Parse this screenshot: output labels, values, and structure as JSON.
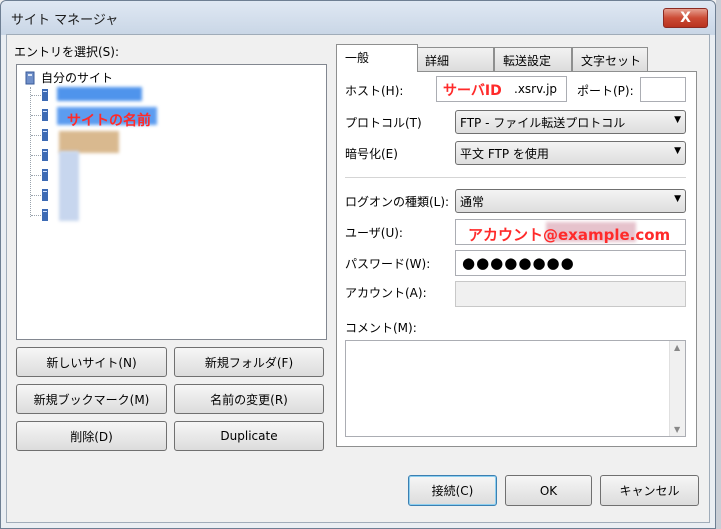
{
  "window": {
    "title": "サイト マネージャ",
    "close": "X"
  },
  "left": {
    "entry_label": "エントリを選択(S):",
    "root": "自分のサイト",
    "site_note": "サイトの名前"
  },
  "buttons": {
    "new_site": "新しいサイト(N)",
    "new_folder": "新規フォルダ(F)",
    "new_bookmark": "新規ブックマーク(M)",
    "rename": "名前の変更(R)",
    "delete": "削除(D)",
    "duplicate": "Duplicate",
    "connect": "接続(C)",
    "ok": "OK",
    "cancel": "キャンセル"
  },
  "tabs": [
    "一般",
    "詳細",
    "転送設定",
    "文字セット"
  ],
  "form": {
    "host_label": "ホスト(H):",
    "host_note": "サーバID",
    "host_value": ".xsrv.jp",
    "port_label": "ポート(P):",
    "port_value": "",
    "protocol_label": "プロトコル(T)",
    "protocol_value": "FTP - ファイル転送プロトコル",
    "encryption_label": "暗号化(E)",
    "encryption_value": "平文 FTP を使用",
    "logon_label": "ログオンの種類(L):",
    "logon_value": "通常",
    "user_label": "ユーザ(U):",
    "user_note": "アカウント@example.com",
    "password_label": "パスワード(W):",
    "password_value": "●●●●●●●●",
    "account_label": "アカウント(A):",
    "comment_label": "コメント(M):"
  },
  "icons": {
    "dropdown": "chevron-down-icon",
    "folder": "folder-icon",
    "server": "server-icon"
  }
}
